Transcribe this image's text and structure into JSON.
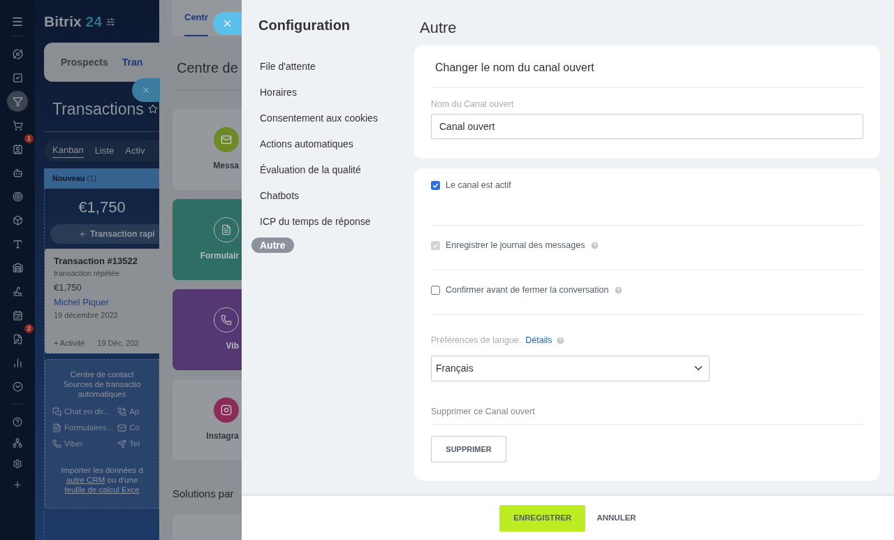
{
  "sidebar": {
    "items": [
      {
        "selected": false
      },
      {
        "selected": false
      },
      {
        "selected": true
      },
      {
        "selected": false
      },
      {
        "selected": false,
        "badge": "1"
      },
      {
        "selected": false
      },
      {
        "selected": false
      },
      {
        "selected": false
      },
      {
        "selected": false
      },
      {
        "selected": false
      },
      {
        "selected": false
      },
      {
        "selected": false
      },
      {
        "selected": false,
        "badge": "2"
      },
      {
        "selected": false
      },
      {
        "selected": false
      }
    ]
  },
  "crm": {
    "logo": {
      "name": "Bitrix",
      "number": "24"
    },
    "tabs": [
      {
        "label": "Prospects",
        "selected": false
      },
      {
        "label": "Tran",
        "selected": true
      }
    ],
    "title": "Transactions",
    "views": [
      {
        "label": "Kanban",
        "selected": true
      },
      {
        "label": "Liste",
        "selected": false
      },
      {
        "label": "Activ",
        "selected": false
      }
    ],
    "column": {
      "name": "Nouveau",
      "count": "(1)",
      "total": "€1,750",
      "add_button": "Transaction rapi"
    },
    "card": {
      "title": "Transaction #13522",
      "subtitle": "transaction répétée",
      "amount": "€1,750",
      "contact": "Michel Piquer",
      "date": "19 décembre 2023",
      "activity": "+ Activité",
      "short_date": "19 Déc. 202"
    },
    "contact_center": {
      "lines": [
        "Centre de contact",
        "Sources de transactio",
        "automatiques"
      ],
      "sources": [
        {
          "label": "Chat en dir..."
        },
        {
          "label": "Ap"
        },
        {
          "label": "Formulaires..."
        },
        {
          "label": "Co"
        },
        {
          "label": "Viber"
        },
        {
          "label": "Tel"
        }
      ],
      "import": {
        "before": "Importer les données d",
        "link1": "autre CRM",
        "middle": "ou d'une",
        "link2": "feuille de calcul Exce"
      }
    }
  },
  "contact_panel": {
    "tab": "Centr",
    "title": "Centre de",
    "cards": [
      {
        "label": "Messa",
        "kind": "icon",
        "color": "#6e8a26"
      },
      {
        "label": "Formulair",
        "kind": "filled",
        "color": "#2f6e65"
      },
      {
        "label": "Vib",
        "kind": "filled",
        "color": "#553873"
      },
      {
        "label": "Instagra",
        "kind": "icon",
        "color": "#8c2a58"
      }
    ],
    "section": "Solutions par"
  },
  "config": {
    "title": "Configuration",
    "menu": [
      {
        "label": "File d'attente",
        "selected": false
      },
      {
        "label": "Horaires",
        "selected": false
      },
      {
        "label": "Consentement aux cookies",
        "selected": false
      },
      {
        "label": "Actions automatiques",
        "selected": false
      },
      {
        "label": "Évaluation de la qualité",
        "selected": false
      },
      {
        "label": "Chatbots",
        "selected": false
      },
      {
        "label": "ICP du temps de réponse",
        "selected": false
      },
      {
        "label": "Autre",
        "selected": true
      }
    ],
    "page_title": "Autre",
    "rename": {
      "title": "Changer le nom du canal ouvert",
      "label": "Nom du Canal ouvert",
      "value": "Canal ouvert"
    },
    "options": [
      {
        "label": "Le canal est actif",
        "checked": true,
        "disabled": false,
        "help": false
      },
      {
        "label": "Enregistrer le journal des messages",
        "checked": true,
        "disabled": true,
        "help": true
      },
      {
        "label": "Confirmer avant de fermer la conversation",
        "checked": false,
        "disabled": false,
        "help": true
      }
    ],
    "language": {
      "label": "Préférences de langue.",
      "link": "Détails",
      "value": "Français"
    },
    "delete": {
      "label": "Supprimer ce Canal ouvert",
      "button": "SUPPRIMER"
    },
    "footer": {
      "save": "ENREGISTRER",
      "cancel": "ANNULER"
    }
  }
}
